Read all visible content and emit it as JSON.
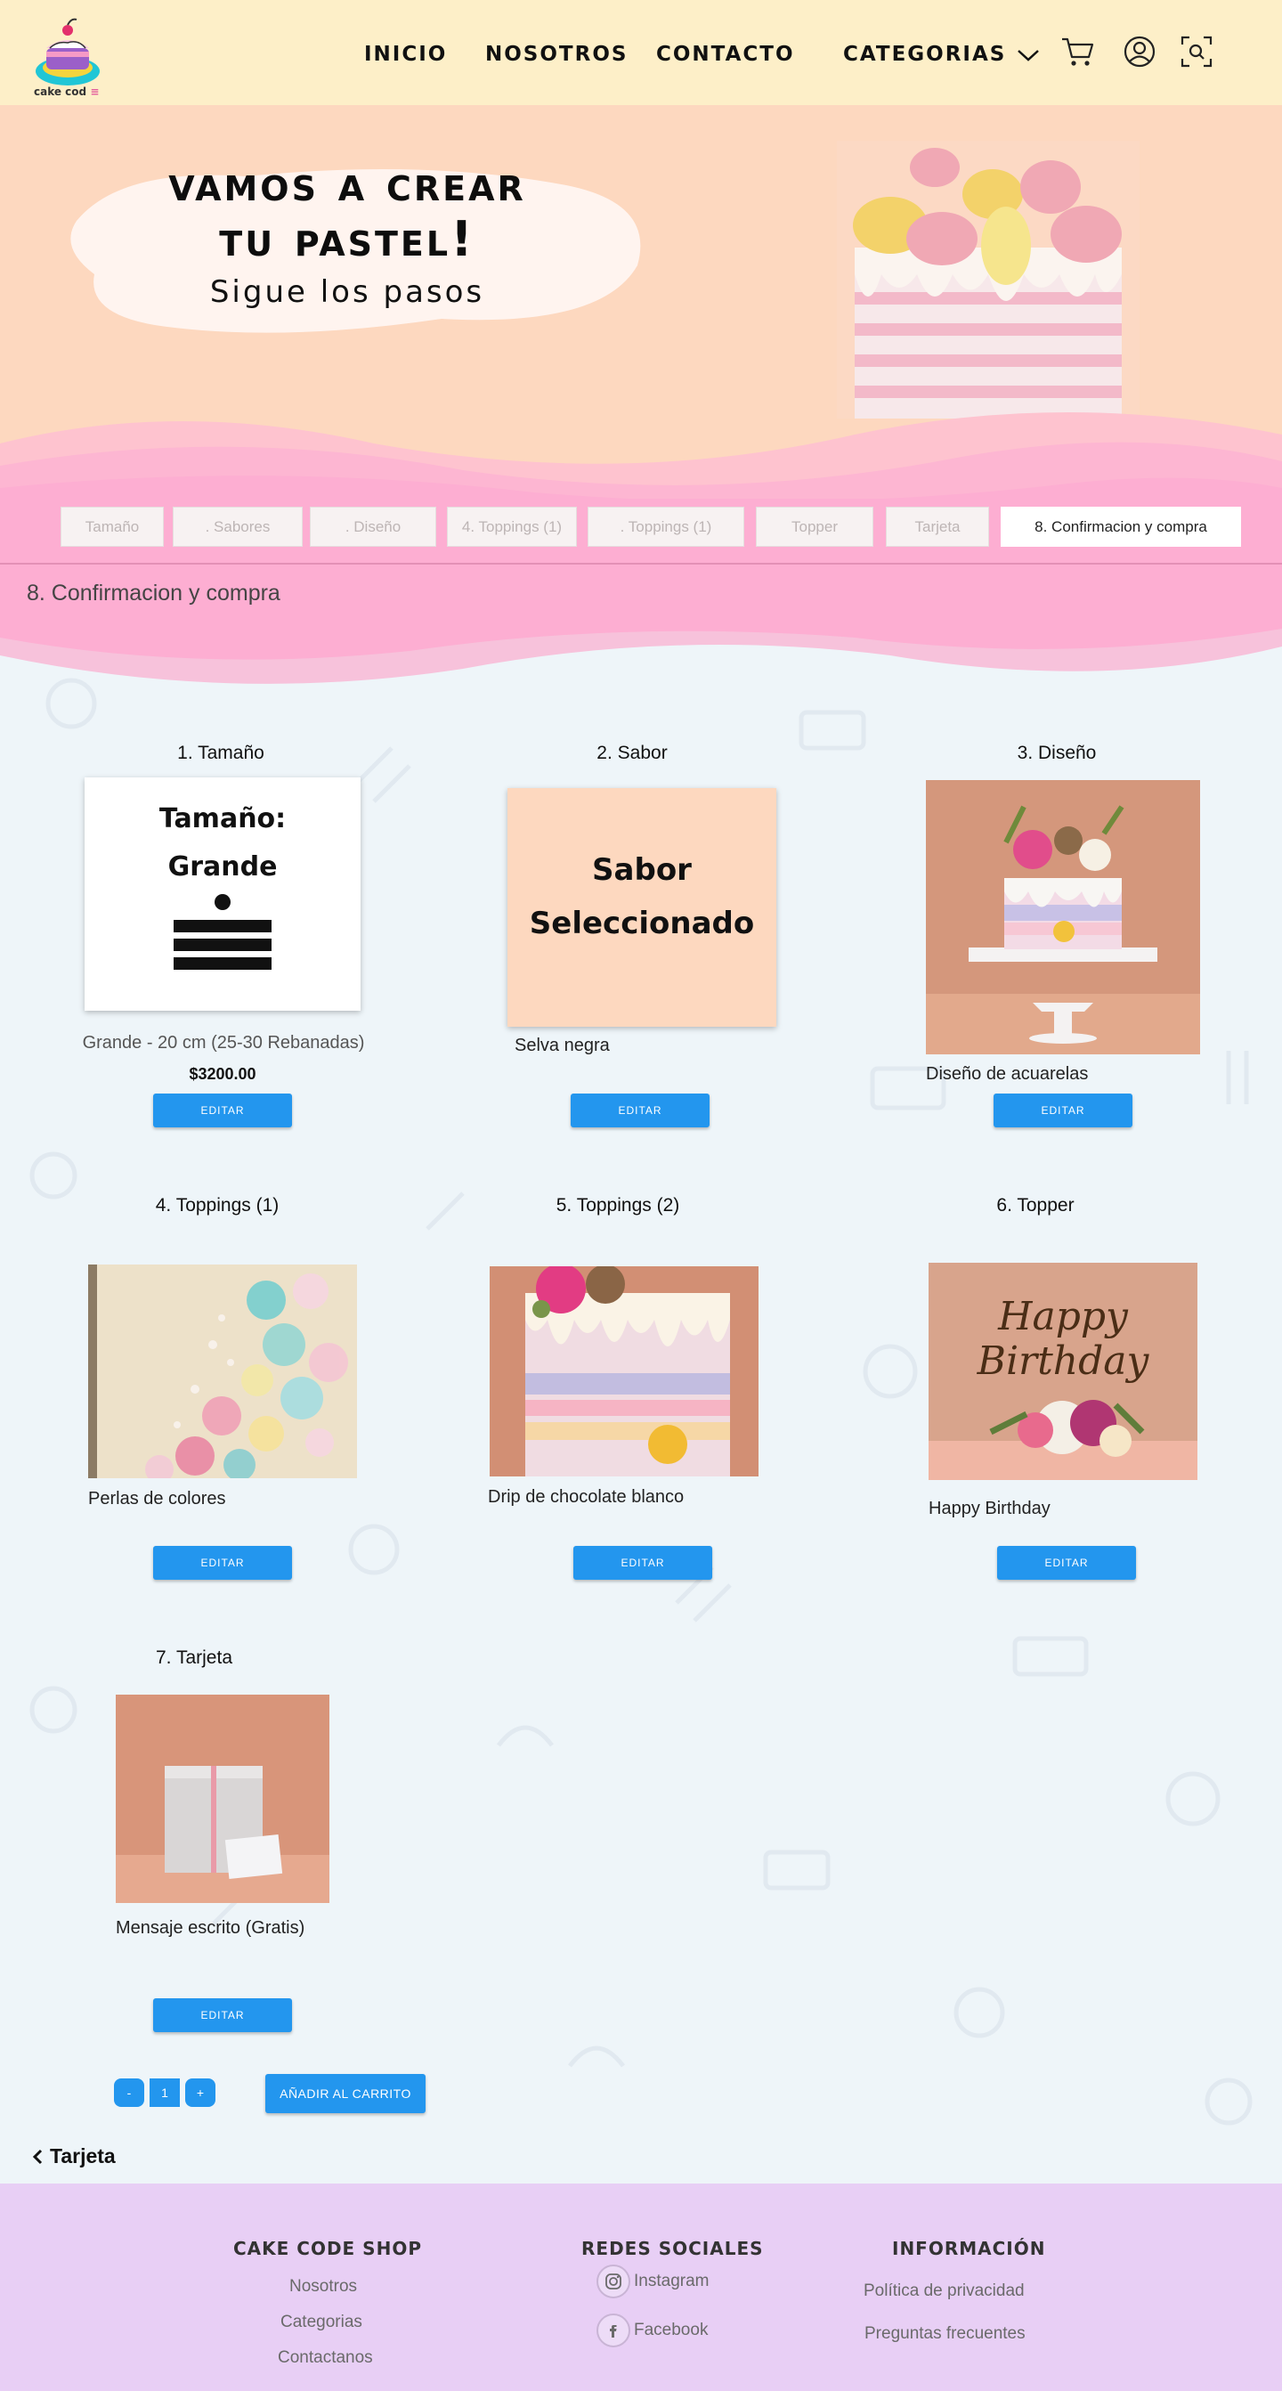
{
  "brand": {
    "logo_text": "cake cod",
    "logo_suffix": "≡"
  },
  "nav": {
    "links": [
      "INICIO",
      "NOSOTROS",
      "CONTACTO",
      "CATEGORIAS"
    ]
  },
  "hero": {
    "title_line1": "Vamos a crear",
    "title_line2": "tu pastel!",
    "subtitle": "Sigue los pasos"
  },
  "steps": {
    "tabs": [
      "Tamaño",
      ". Sabores",
      ". Diseño",
      "4. Toppings (1)",
      ". Toppings (1)",
      "Topper",
      "Tarjeta",
      "8. Confirmacion y compra"
    ],
    "current_title": "8. Confirmacion y compra"
  },
  "summary": {
    "edit_label": "EDITAR",
    "items": [
      {
        "title": "1. Tamaño",
        "card_line1": "Tamaño:",
        "card_line2": "Grande",
        "caption": "Grande - 20 cm (25-30 Rebanadas)",
        "price": "$3200.00"
      },
      {
        "title": "2. Sabor",
        "card_line1": "Sabor",
        "card_line2": "Seleccionado",
        "caption": "Selva negra"
      },
      {
        "title": "3. Diseño",
        "caption": "Diseño de acuarelas"
      },
      {
        "title": "4. Toppings (1)",
        "caption": "Perlas de colores"
      },
      {
        "title": "5. Toppings (2)",
        "caption": "Drip de chocolate blanco"
      },
      {
        "title": "6. Topper",
        "caption": "Happy Birthday",
        "topper_line1": "Happy",
        "topper_line2": "Birthday"
      },
      {
        "title": "7. Tarjeta",
        "caption": "Mensaje escrito (Gratis)"
      }
    ]
  },
  "quantity": {
    "minus": "-",
    "value": "1",
    "plus": "+"
  },
  "cart_button": "AÑADIR AL CARRITO",
  "back_link": "Tarjeta",
  "footer": {
    "col1": {
      "heading": "CAKE CODE SHOP",
      "links": [
        "Nosotros",
        "Categorias",
        "Contactanos"
      ]
    },
    "col2": {
      "heading": "REDES SOCIALES",
      "links": [
        "Instagram",
        "Facebook"
      ]
    },
    "col3": {
      "heading": "INFORMACIÓN",
      "links": [
        "Política de privacidad",
        "Preguntas frecuentes"
      ]
    }
  },
  "colors": {
    "nav_bg": "#fdefc8",
    "hero_bg": "#fdd8bf",
    "pink": "#fdaed2",
    "accent_blue": "#2396ee",
    "footer_bg": "#e8cff5",
    "content_bg": "#eef5f9"
  },
  "icons": [
    "cart-icon",
    "user-icon",
    "scan-icon",
    "chevron-down-icon",
    "chevron-left-icon",
    "instagram-icon",
    "facebook-icon"
  ]
}
